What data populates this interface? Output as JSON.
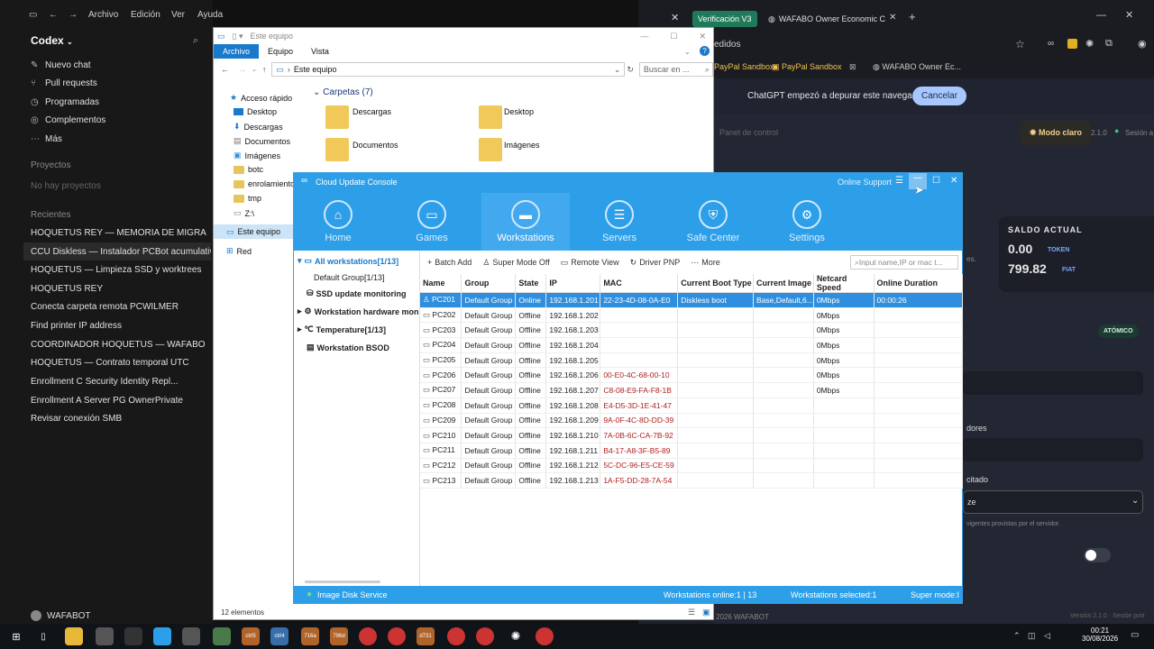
{
  "codex": {
    "menu": [
      "Archivo",
      "Edición",
      "Ver",
      "Ayuda"
    ],
    "app_title": "Codex",
    "nav": [
      {
        "label": "Nuevo chat",
        "icon": "edit-icon"
      },
      {
        "label": "Pull requests",
        "icon": "pull-request-icon"
      },
      {
        "label": "Programadas",
        "icon": "clock-icon"
      },
      {
        "label": "Complementos",
        "icon": "plugin-icon"
      },
      {
        "label": "Más",
        "icon": "more-icon"
      }
    ],
    "projects_header": "Proyectos",
    "projects_empty": "No hay proyectos",
    "recent_header": "Recientes",
    "recents": [
      "HOQUETUS REY — MEMORIA DE MIGRA",
      "CCU Diskless — Instalador PCBot acumulativo",
      "HOQUETUS — Limpieza SSD y worktrees",
      "HOQUETUS REY",
      "Conecta carpeta remota PCWILMER",
      "Find printer IP address",
      "COORDINADOR HOQUETUS — WAFABO",
      "HOQUETUS — Contrato temporal UTC",
      "Enrollment C Security Identity Repl...",
      "Enrollment A Server PG OwnerPrivate",
      "Revisar conexión SMB"
    ],
    "user": "WAFABOT"
  },
  "browser": {
    "tab1": "Verificación V3",
    "tab2": "WAFABO Owner Economic Cor",
    "address": "edidos",
    "bookmarks": [
      "PayPal Sandbox",
      "PayPal Sandbox",
      "WAFABO Owner Ec..."
    ],
    "banner_text": "ChatGPT empezó a depurar este navegador",
    "banner_button": "Cancelar",
    "modo_claro": "Modo claro",
    "version": "2.1.0",
    "session": "Sesión a",
    "panel": "Panel de control",
    "saldo_label": "SALDO ACTUAL",
    "saldo_token": "0.00",
    "token_unit": "TOKEN",
    "saldo_fiat": "799.82",
    "fiat_unit": "FIAT",
    "res": "es.",
    "atomic": "ATÓMICO",
    "dores": "dores",
    "citado": "citado",
    "ze": "ze",
    "hint": "vigentes provistas por el servidor.",
    "footer_left": "2026 WAFABOT",
    "footer_right": "Versión 2.1.0 · Sesión prot"
  },
  "explorer": {
    "title": "Este equipo",
    "ribbon": [
      "Archivo",
      "Equipo",
      "Vista"
    ],
    "path": "Este equipo",
    "search_placeholder": "Buscar en ...",
    "quick_access": "Acceso rápido",
    "nav": [
      "Desktop",
      "Descargas",
      "Documentos",
      "Imágenes",
      "botc",
      "enrolamiento",
      "tmp",
      "Z:\\"
    ],
    "this_pc": "Este equipo",
    "network": "Red",
    "group_header": "Carpetas (7)",
    "folders": [
      "Descargas",
      "Desktop",
      "Documentos",
      "Imágenes"
    ],
    "status": "12 elementos"
  },
  "ccu": {
    "title": "Cloud Update Console",
    "online_support": "Online Support",
    "nav": [
      {
        "label": "Home",
        "icon": "home-icon"
      },
      {
        "label": "Games",
        "icon": "folder-icon"
      },
      {
        "label": "Workstations",
        "icon": "monitor-icon"
      },
      {
        "label": "Servers",
        "icon": "server-icon"
      },
      {
        "label": "Safe Center",
        "icon": "shield-icon"
      },
      {
        "label": "Settings",
        "icon": "gear-icon"
      }
    ],
    "tree": {
      "all": "All workstations[1/13]",
      "default_group": "Default Group[1/13]",
      "ssd": "SSD update monitoring",
      "hw": "Workstation hardware mon",
      "temp": "Temperature[1/13]",
      "bsod": "Workstation BSOD"
    },
    "actions": [
      "Batch Add",
      "Super Mode Off",
      "Remote View",
      "Driver PNP",
      "More"
    ],
    "search_placeholder": "Input name,IP or mac t...",
    "columns": [
      "Name",
      "Group",
      "State",
      "IP",
      "MAC",
      "Current Boot Type",
      "Current Image",
      "Netcard Speed",
      "Online Duration"
    ],
    "rows": [
      {
        "name": "PC201",
        "group": "Default Group",
        "state": "Online",
        "ip": "192.168.1.201",
        "mac": "22-23-4D-08-0A-E0",
        "boot": "Diskless boot",
        "image": "Base,Default,6...",
        "speed": "0Mbps",
        "duration": "00:00:26"
      },
      {
        "name": "PC202",
        "group": "Default Group",
        "state": "Offline",
        "ip": "192.168.1.202",
        "mac": "",
        "boot": "",
        "image": "",
        "speed": "0Mbps",
        "duration": ""
      },
      {
        "name": "PC203",
        "group": "Default Group",
        "state": "Offline",
        "ip": "192.168.1.203",
        "mac": "",
        "boot": "",
        "image": "",
        "speed": "0Mbps",
        "duration": ""
      },
      {
        "name": "PC204",
        "group": "Default Group",
        "state": "Offline",
        "ip": "192.168.1.204",
        "mac": "",
        "boot": "",
        "image": "",
        "speed": "0Mbps",
        "duration": ""
      },
      {
        "name": "PC205",
        "group": "Default Group",
        "state": "Offline",
        "ip": "192.168.1.205",
        "mac": "",
        "boot": "",
        "image": "",
        "speed": "0Mbps",
        "duration": ""
      },
      {
        "name": "PC206",
        "group": "Default Group",
        "state": "Offline",
        "ip": "192.168.1.206",
        "mac": "00-E0-4C-68-00-10",
        "boot": "",
        "image": "",
        "speed": "0Mbps",
        "duration": ""
      },
      {
        "name": "PC207",
        "group": "Default Group",
        "state": "Offline",
        "ip": "192.168.1.207",
        "mac": "C8-08-E9-FA-F8-1B",
        "boot": "",
        "image": "",
        "speed": "0Mbps",
        "duration": ""
      },
      {
        "name": "PC208",
        "group": "Default Group",
        "state": "Offline",
        "ip": "192.168.1.208",
        "mac": "E4-D5-3D-1E-41-47",
        "boot": "",
        "image": "",
        "speed": "",
        "duration": ""
      },
      {
        "name": "PC209",
        "group": "Default Group",
        "state": "Offline",
        "ip": "192.168.1.209",
        "mac": "9A-0F-4C-8D-DD-39",
        "boot": "",
        "image": "",
        "speed": "",
        "duration": ""
      },
      {
        "name": "PC210",
        "group": "Default Group",
        "state": "Offline",
        "ip": "192.168.1.210",
        "mac": "7A-0B-6C-CA-7B-92",
        "boot": "",
        "image": "",
        "speed": "",
        "duration": ""
      },
      {
        "name": "PC211",
        "group": "Default Group",
        "state": "Offline",
        "ip": "192.168.1.211",
        "mac": "B4-17-A8-3F-B5-89",
        "boot": "",
        "image": "",
        "speed": "",
        "duration": ""
      },
      {
        "name": "PC212",
        "group": "Default Group",
        "state": "Offline",
        "ip": "192.168.1.212",
        "mac": "5C-DC-96-E5-CE-59",
        "boot": "",
        "image": "",
        "speed": "",
        "duration": ""
      },
      {
        "name": "PC213",
        "group": "Default Group",
        "state": "Offline",
        "ip": "192.168.1.213",
        "mac": "1A-F5-DD-28-7A-54",
        "boot": "",
        "image": "",
        "speed": "",
        "duration": ""
      }
    ],
    "status": {
      "service": "Image Disk Service",
      "online": "Workstations online:1 | 13",
      "selected": "Workstations selected:1",
      "mode": "Super mode:I"
    }
  },
  "taskbar": {
    "labels": [
      "ctrl5",
      "ctrl4",
      "716a",
      "796d",
      "d731"
    ],
    "clock_time": "00:21",
    "clock_date": "30/08/2026"
  },
  "colors": {
    "ccu_blue": "#2d9fe8",
    "selected_row": "#2f8fde",
    "mac_red": "#b02020"
  }
}
